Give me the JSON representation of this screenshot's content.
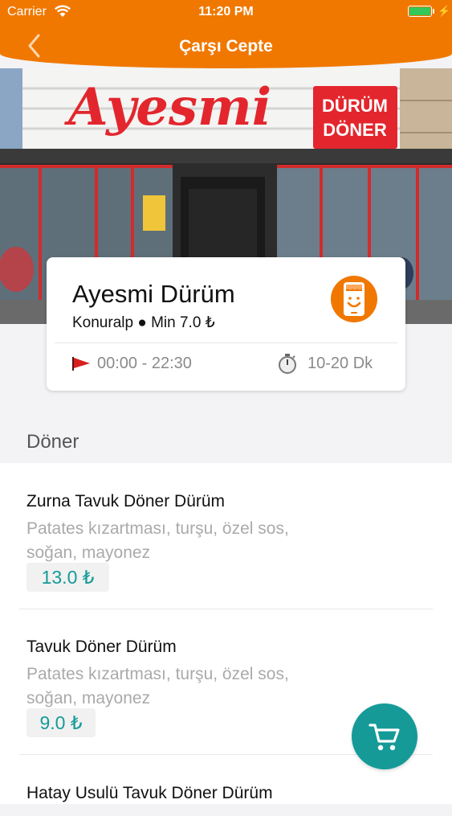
{
  "status_bar": {
    "carrier": "Carrier",
    "time": "11:20 PM"
  },
  "nav": {
    "title": "Çarşı Cepte"
  },
  "restaurant": {
    "sign_text": "Ayesmi",
    "sign_badge_line1": "DÜRÜM",
    "sign_badge_line2": "DÖNER",
    "name": "Ayesmi Dürüm",
    "subtitle": "Konuralp ● Min 7.0 ₺",
    "hours": "00:00 - 22:30",
    "delivery_time": "10-20 Dk"
  },
  "section": {
    "title": "Döner"
  },
  "menu_items": [
    {
      "name": "Zurna Tavuk Döner Dürüm",
      "desc_line1": "Patates kızartması, turşu, özel sos,",
      "desc_line2": "soğan, mayonez",
      "price": "13.0 ₺"
    },
    {
      "name": "Tavuk Döner Dürüm",
      "desc_line1": "Patates kızartması, turşu, özel sos,",
      "desc_line2": "soğan, mayonez",
      "price": "9.0 ₺"
    },
    {
      "name": "Hatay Usulü Tavuk Döner Dürüm"
    }
  ],
  "icons": {
    "back": "chevron-left-icon",
    "flag": "flag-icon",
    "timer": "stopwatch-icon",
    "cart": "shopping-cart-icon",
    "logo": "phone-shop-logo-icon"
  },
  "colors": {
    "brand": "#f07800",
    "accent": "#159a98",
    "sign_red": "#e3262d"
  }
}
